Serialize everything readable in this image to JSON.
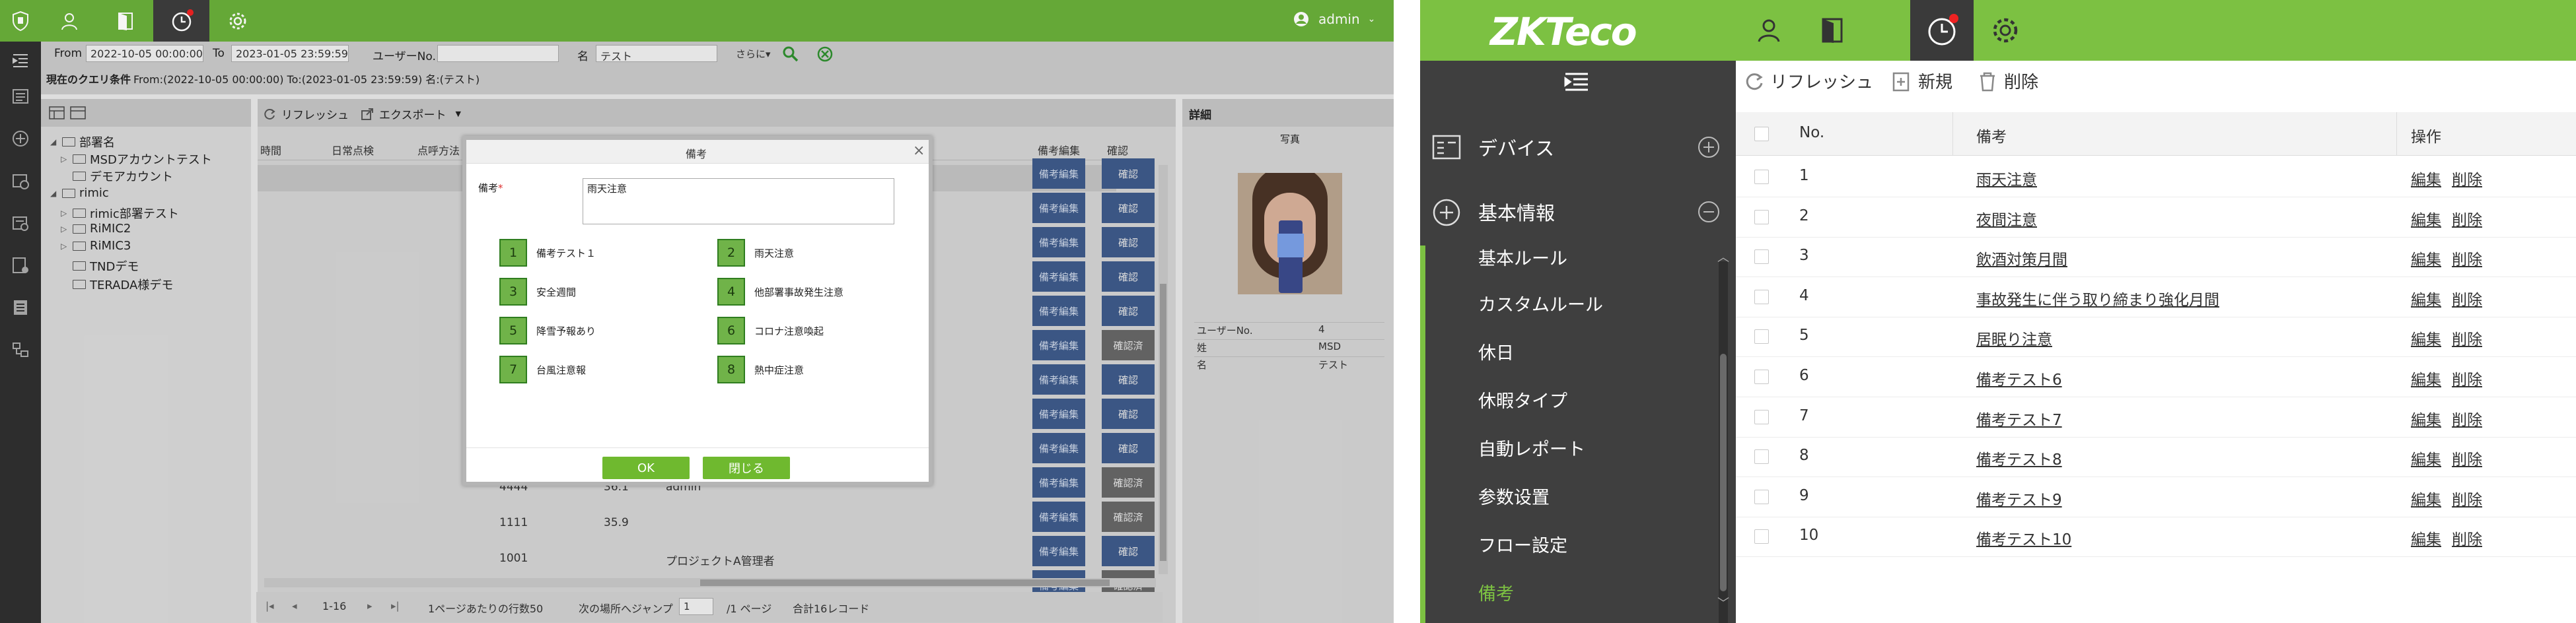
{
  "left": {
    "user": "admin",
    "filters": {
      "from_label": "From",
      "from_value": "2022-10-05 00:00:00",
      "to_label": "To",
      "to_value": "2023-01-05 23:59:59",
      "user_no_label": "ユーザーNo.",
      "user_no_value": "",
      "name_label": "名",
      "name_value": "テスト",
      "more_label": "さらに▾",
      "query_text": "現在のクエリ条件",
      "query_detail": "From:(2022-10-05 00:00:00)  To:(2023-01-05 23:59:59)  名:(テスト)"
    },
    "tree": [
      {
        "label": "部署名",
        "level": 0
      },
      {
        "label": "MSDアカウントテスト",
        "level": 1
      },
      {
        "label": "デモアカウント",
        "level": 1
      },
      {
        "label": "rimic",
        "level": 0
      },
      {
        "label": "rimic部署テスト",
        "level": 1
      },
      {
        "label": "RiMIC2",
        "level": 1
      },
      {
        "label": "RiMIC3",
        "level": 1
      },
      {
        "label": "TNDデモ",
        "level": 1
      },
      {
        "label": "TERADA様デモ",
        "level": 1
      }
    ],
    "toolbar": {
      "refresh": "リフレッシュ",
      "export": "エクスポート"
    },
    "columns": {
      "c1": "時間",
      "c2": "日常点検",
      "c3": "点呼方法",
      "c_edit": "備考編集",
      "c_confirm": "確認"
    },
    "edit_label": "備考編集",
    "confirm_rows": [
      "確認",
      "確認",
      "確認",
      "確認",
      "確認",
      "確認済",
      "確認",
      "確認",
      "確認",
      "確認済",
      "確認済",
      "確認",
      "確認済"
    ],
    "visible_rows": [
      {
        "id": "4444",
        "value": "36.1",
        "name": "admin"
      },
      {
        "id": "1111",
        "value": "35.9",
        "name": ""
      },
      {
        "id": "1001",
        "value": "",
        "name": "プロジェクトA管理者"
      }
    ],
    "pager": {
      "range": "1-16",
      "per_page": "1ページあたりの行数50",
      "jump": "次の場所へジャンプ",
      "page_value": "1",
      "page_total": "/1 ページ",
      "total": "合計16レコード"
    },
    "detail": {
      "title": "詳細",
      "photo_label": "写真",
      "fields": [
        {
          "k": "ユーザーNo.",
          "v": "4"
        },
        {
          "k": "姓",
          "v": "MSD"
        },
        {
          "k": "名",
          "v": "テスト"
        }
      ]
    },
    "modal": {
      "title": "備考",
      "remark_label": "備考",
      "required_mark": "*",
      "remark_value": "雨天注意",
      "items": [
        {
          "n": "1",
          "t": "備考テスト１"
        },
        {
          "n": "2",
          "t": "雨天注意"
        },
        {
          "n": "3",
          "t": "安全週間"
        },
        {
          "n": "4",
          "t": "他部署事故発生注意"
        },
        {
          "n": "5",
          "t": "降雪予報あり"
        },
        {
          "n": "6",
          "t": "コロナ注意喚起"
        },
        {
          "n": "7",
          "t": "台風注意報"
        },
        {
          "n": "8",
          "t": "熱中症注意"
        }
      ],
      "ok": "OK",
      "close": "閉じる"
    }
  },
  "right": {
    "logo": "ZKTeco",
    "side": {
      "devices": "デバイス",
      "basic": "基本情報",
      "sub": [
        "基本ルール",
        "カスタムルール",
        "休日",
        "休暇タイプ",
        "自動レポート",
        "参数设置",
        "フロー設定",
        "備考"
      ]
    },
    "toolbar": {
      "refresh": "リフレッシュ",
      "new": "新規",
      "delete": "削除"
    },
    "table": {
      "headers": {
        "no": "No.",
        "remark": "備考",
        "op": "操作"
      },
      "edit": "編集",
      "del": "削除",
      "rows": [
        {
          "no": "1",
          "remark": "雨天注意"
        },
        {
          "no": "2",
          "remark": "夜間注意"
        },
        {
          "no": "3",
          "remark": "飲酒対策月間"
        },
        {
          "no": "4",
          "remark": "事故発生に伴う取り締まり強化月間"
        },
        {
          "no": "5",
          "remark": "居眠り注意"
        },
        {
          "no": "6",
          "remark": "備考テスト6"
        },
        {
          "no": "7",
          "remark": "備考テスト7"
        },
        {
          "no": "8",
          "remark": "備考テスト8"
        },
        {
          "no": "9",
          "remark": "備考テスト9"
        },
        {
          "no": "10",
          "remark": "備考テスト10"
        }
      ]
    }
  },
  "colors": {
    "green": "#6aaf3a",
    "green_bright": "#7cc142",
    "dark": "#3f3f3f",
    "blue_btn": "#3e5a8a"
  }
}
